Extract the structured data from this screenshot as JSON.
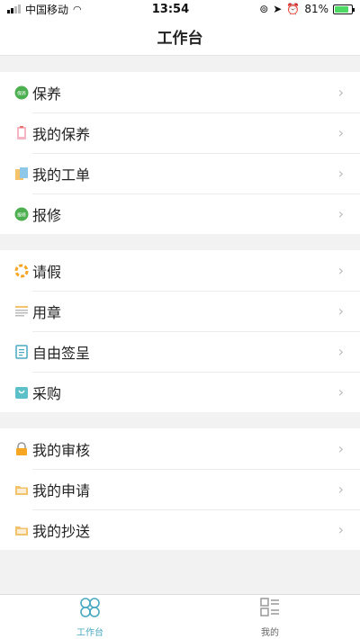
{
  "status": {
    "carrier": "中国移动",
    "time": "13:54",
    "battery": "81%"
  },
  "header": {
    "title": "工作台"
  },
  "groups": [
    {
      "items": [
        {
          "label": "保养"
        },
        {
          "label": "我的保养"
        },
        {
          "label": "我的工单"
        },
        {
          "label": "报修"
        }
      ]
    },
    {
      "items": [
        {
          "label": "请假"
        },
        {
          "label": "用章"
        },
        {
          "label": "自由签呈"
        },
        {
          "label": "采购"
        }
      ]
    },
    {
      "items": [
        {
          "label": "我的审核"
        },
        {
          "label": "我的申请"
        },
        {
          "label": "我的抄送"
        }
      ]
    }
  ],
  "tabs": [
    {
      "label": "工作台",
      "active": true
    },
    {
      "label": "我的",
      "active": false
    }
  ],
  "colors": {
    "accent": "#4aa8c0",
    "green": "#4caf50",
    "orange": "#f5a623",
    "folder": "#f2c36b"
  }
}
